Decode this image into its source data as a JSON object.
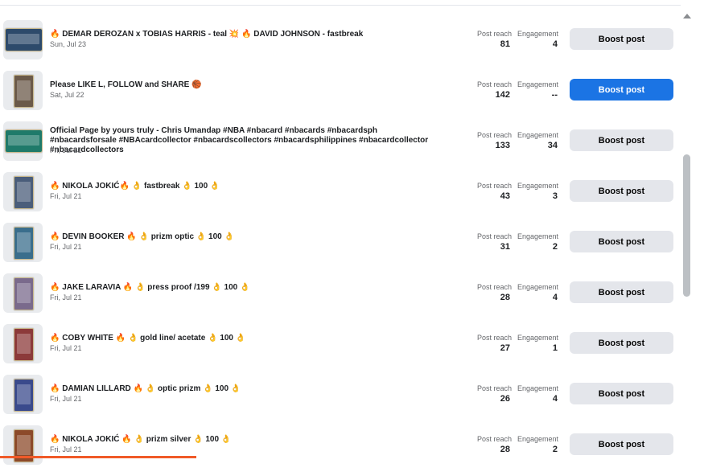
{
  "posts": [
    {
      "title": "🔥 DEMAR DEROZAN x TOBIAS HARRIS - teal 💥 🔥 DAVID JOHNSON - fastbreak",
      "date": "Sun, Jul 23",
      "reach_label": "Post reach",
      "reach": "81",
      "engagement_label": "Engagement",
      "engagement": "4",
      "boost_label": "Boost post",
      "thumb_color": "#2d4a6b"
    },
    {
      "title": "Please LIKE L, FOLLOW and SHARE 🏀",
      "date": "Sat, Jul 22",
      "reach_label": "Post reach",
      "reach": "142",
      "engagement_label": "Engagement",
      "engagement": "--",
      "boost_label": "Boost post",
      "thumb_color": "#6b5a4a"
    },
    {
      "title": "Official Page by yours truly - Chris Umandap #NBA #nbacard #nbacards #nbacardsph #nbacardsforsale #NBAcardcollector #nbacardscollectors #nbacardsphilippines #nbacardcollector #nbacardcollectors",
      "date": "Fri, Jul 21",
      "reach_label": "Post reach",
      "reach": "133",
      "engagement_label": "Engagement",
      "engagement": "34",
      "boost_label": "Boost post",
      "thumb_color": "#1f7a6a"
    },
    {
      "title": "🔥 NIKOLA JOKIĆ🔥 👌 fastbreak 👌 100 👌",
      "date": "Fri, Jul 21",
      "reach_label": "Post reach",
      "reach": "43",
      "engagement_label": "Engagement",
      "engagement": "3",
      "boost_label": "Boost post",
      "thumb_color": "#4a5d7a"
    },
    {
      "title": "🔥 DEVIN BOOKER 🔥 👌 prizm optic 👌 100 👌",
      "date": "Fri, Jul 21",
      "reach_label": "Post reach",
      "reach": "31",
      "engagement_label": "Engagement",
      "engagement": "2",
      "boost_label": "Boost post",
      "thumb_color": "#3a6e8c"
    },
    {
      "title": "🔥 JAKE LARAVIA 🔥 👌 press proof /199 👌 100 👌",
      "date": "Fri, Jul 21",
      "reach_label": "Post reach",
      "reach": "28",
      "engagement_label": "Engagement",
      "engagement": "4",
      "boost_label": "Boost post",
      "thumb_color": "#7a6a8c"
    },
    {
      "title": "🔥 COBY WHITE 🔥 👌 gold line/ acetate 👌 100 👌",
      "date": "Fri, Jul 21",
      "reach_label": "Post reach",
      "reach": "27",
      "engagement_label": "Engagement",
      "engagement": "1",
      "boost_label": "Boost post",
      "thumb_color": "#8c3a3a"
    },
    {
      "title": "🔥 DAMIAN LILLARD 🔥 👌 optic prizm 👌 100 👌",
      "date": "Fri, Jul 21",
      "reach_label": "Post reach",
      "reach": "26",
      "engagement_label": "Engagement",
      "engagement": "4",
      "boost_label": "Boost post",
      "thumb_color": "#3a4a8c"
    },
    {
      "title": "🔥 NIKOLA JOKIĆ 🔥 👌 prizm silver 👌 100 👌",
      "date": "Fri, Jul 21",
      "reach_label": "Post reach",
      "reach": "28",
      "engagement_label": "Engagement",
      "engagement": "2",
      "boost_label": "Boost post",
      "thumb_color": "#8c4a2a"
    }
  ],
  "highlighted_row": 1,
  "colors": {
    "primary": "#1b74e4",
    "secondary_button": "#e4e6eb",
    "accent_bar": "#f05a28"
  }
}
